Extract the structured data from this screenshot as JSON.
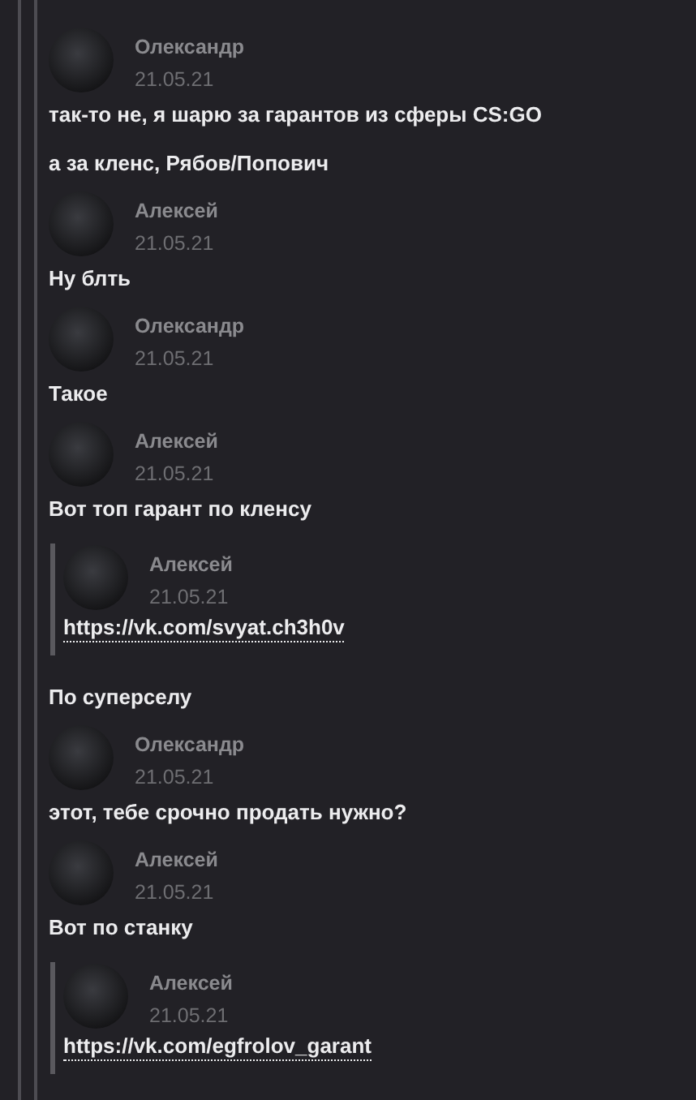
{
  "messages": [
    {
      "author": "Олександр",
      "date": "21.05.21",
      "content": [
        {
          "kind": "text",
          "text": "так-то не, я шарю за гарантов из сферы CS:GO"
        },
        {
          "kind": "text",
          "text": "а за кленс, Рябов/Попович"
        }
      ]
    },
    {
      "author": "Алексей",
      "date": "21.05.21",
      "content": [
        {
          "kind": "text",
          "text": "Ну блть"
        }
      ]
    },
    {
      "author": "Олександр",
      "date": "21.05.21",
      "content": [
        {
          "kind": "text",
          "text": "Такое"
        }
      ]
    },
    {
      "author": "Алексей",
      "date": "21.05.21",
      "content": [
        {
          "kind": "text",
          "text": "Вот топ гарант по кленсу"
        },
        {
          "kind": "forward",
          "author": "Алексей",
          "date": "21.05.21",
          "link": "https://vk.com/svyat.ch3h0v"
        },
        {
          "kind": "text",
          "text": "По суперселу"
        }
      ]
    },
    {
      "author": "Олександр",
      "date": "21.05.21",
      "content": [
        {
          "kind": "text",
          "text": "этот, тебе срочно продать нужно?"
        }
      ]
    },
    {
      "author": "Алексей",
      "date": "21.05.21",
      "content": [
        {
          "kind": "text",
          "text": "Вот по станку"
        },
        {
          "kind": "forward",
          "author": "Алексей",
          "date": "21.05.21",
          "link": "https://vk.com/egfrolov_garant"
        }
      ]
    }
  ]
}
